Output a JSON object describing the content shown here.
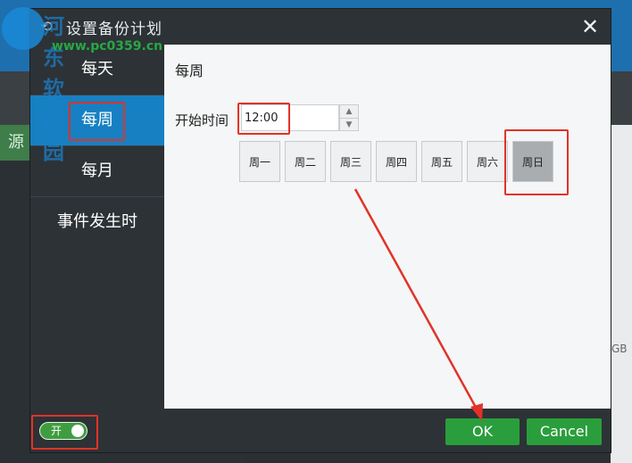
{
  "background": {
    "left_strip_label": "源",
    "right_edge_text": "GB"
  },
  "watermark": {
    "brand": "河东软件园",
    "url": "www.pc0359.cn"
  },
  "dialog": {
    "title": "设置备份计划",
    "close_icon": "✕"
  },
  "sidebar": {
    "items": [
      {
        "label": "每天"
      },
      {
        "label": "每周"
      },
      {
        "label": "每月"
      },
      {
        "label": "事件发生时"
      }
    ],
    "selected_index": 1
  },
  "content": {
    "section_title": "每周",
    "start_time_label": "开始时间",
    "start_time_value": "12:00",
    "days": [
      {
        "label": "周一",
        "selected": false
      },
      {
        "label": "周二",
        "selected": false
      },
      {
        "label": "周三",
        "selected": false
      },
      {
        "label": "周四",
        "selected": false
      },
      {
        "label": "周五",
        "selected": false
      },
      {
        "label": "周六",
        "selected": false
      },
      {
        "label": "周日",
        "selected": true
      }
    ]
  },
  "footer": {
    "toggle_label": "开",
    "toggle_on": true,
    "ok_label": "OK",
    "cancel_label": "Cancel"
  },
  "colors": {
    "accent_blue": "#1680c2",
    "button_green": "#2a9e3c",
    "highlight_red": "#e23228"
  }
}
